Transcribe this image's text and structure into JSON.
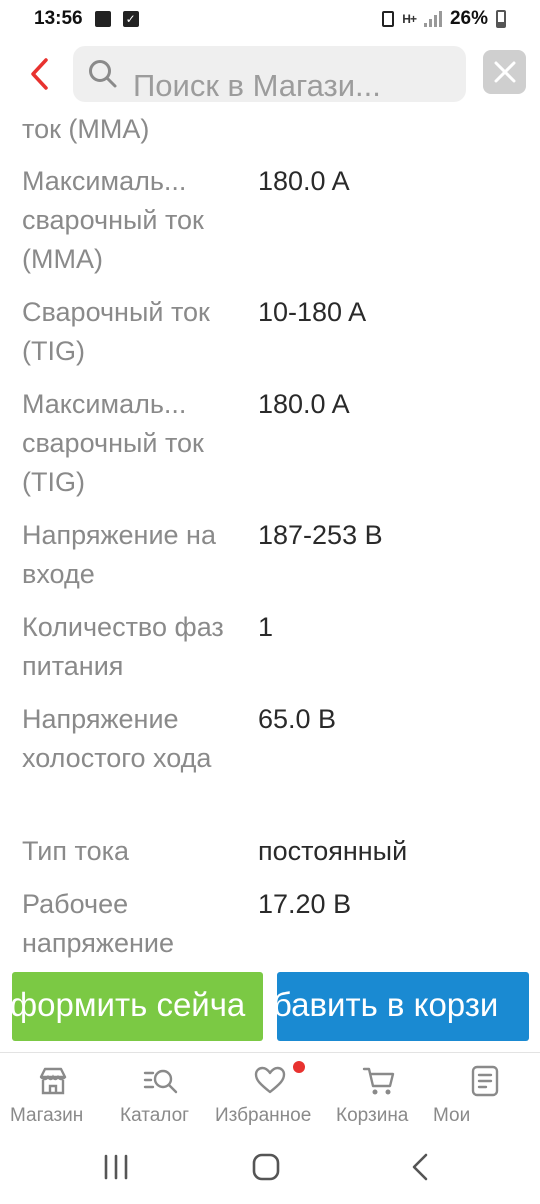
{
  "status_bar": {
    "time": "13:56",
    "battery": "26%",
    "net": "H+"
  },
  "header": {
    "search_placeholder": "Поиск в Магази..."
  },
  "specs": [
    {
      "label": "ток (MMA)",
      "value": ""
    },
    {
      "label": "Максималь... сварочный ток (MMA)",
      "value": "180.0 A"
    },
    {
      "label": "Сварочный ток (TIG)",
      "value": "10-180 A"
    },
    {
      "label": "Максималь... сварочный ток (TIG)",
      "value": "180.0 A"
    },
    {
      "label": "Напряжение на входе",
      "value": "187-253 В"
    },
    {
      "label": "Количество фаз питания",
      "value": "1"
    },
    {
      "label": "Напряжение холостого хода",
      "value": "65.0 В"
    },
    {
      "label": "Тип тока",
      "value": "постоянный"
    },
    {
      "label": "Рабочее напряжение",
      "value": "17.20 В"
    }
  ],
  "actions": {
    "order_label": "формить сейча",
    "cart_label": "бавить в корзи"
  },
  "colors": {
    "order": "#7bc944",
    "cart": "#1a8ad2",
    "accent_red": "#e8322f"
  },
  "nav": [
    {
      "label": "Магазин",
      "icon": "store-icon"
    },
    {
      "label": "Каталог",
      "icon": "catalog-search-icon"
    },
    {
      "label": "Избранное",
      "icon": "heart-icon"
    },
    {
      "label": "Корзина",
      "icon": "cart-icon"
    },
    {
      "label": "Мои",
      "icon": "document-icon"
    }
  ]
}
